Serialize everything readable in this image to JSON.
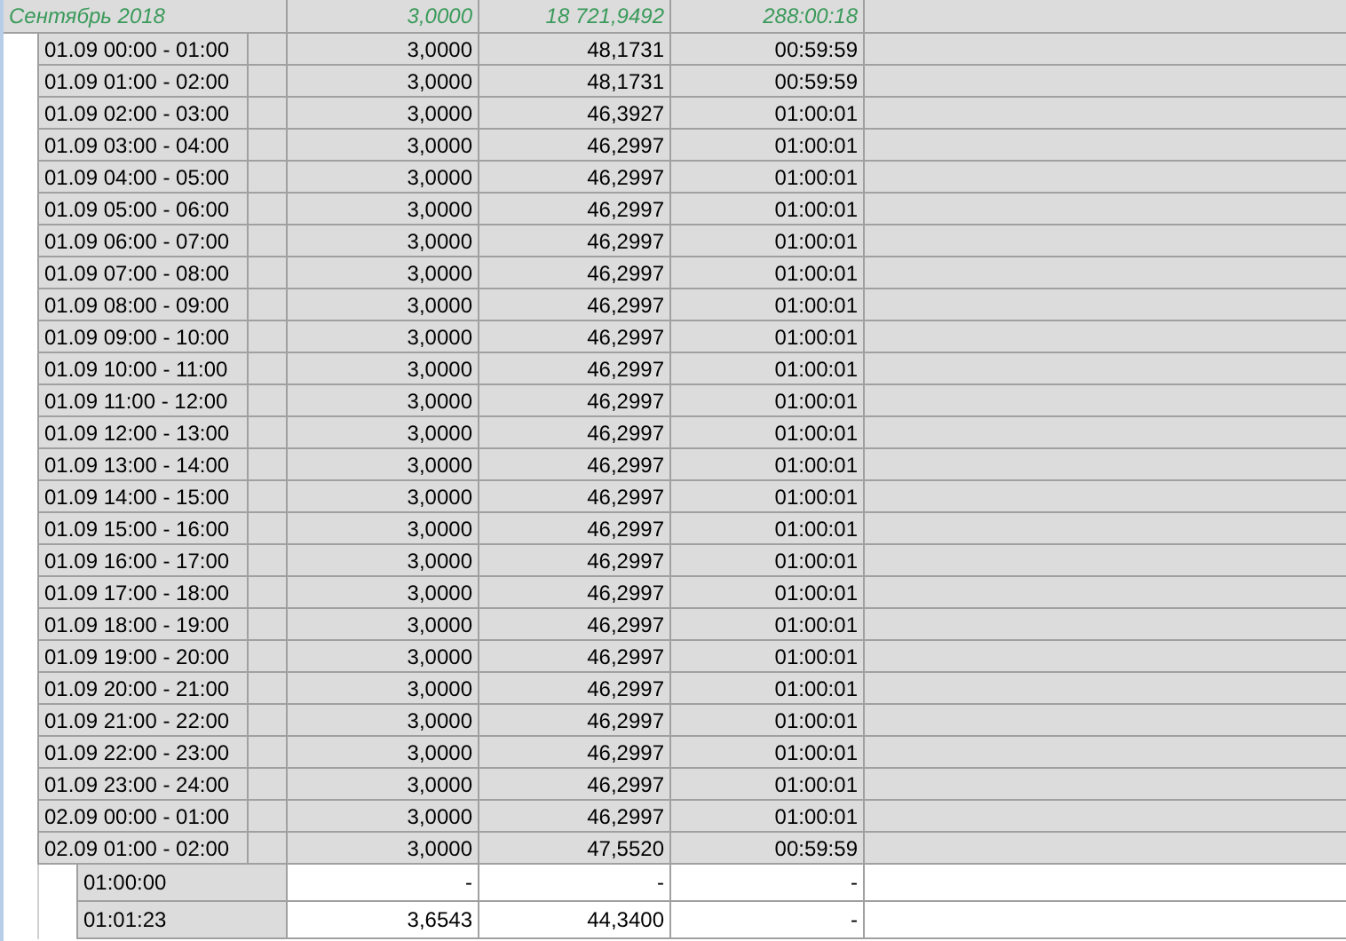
{
  "group_row": {
    "label": "Сентябрь 2018",
    "values": [
      "3,0000",
      "18 721,9492",
      "288:00:18"
    ]
  },
  "rows": [
    {
      "label": "01.09 00:00 - 01:00",
      "values": [
        "3,0000",
        "48,1731",
        "00:59:59"
      ]
    },
    {
      "label": "01.09 01:00 - 02:00",
      "values": [
        "3,0000",
        "48,1731",
        "00:59:59"
      ]
    },
    {
      "label": "01.09 02:00 - 03:00",
      "values": [
        "3,0000",
        "46,3927",
        "01:00:01"
      ]
    },
    {
      "label": "01.09 03:00 - 04:00",
      "values": [
        "3,0000",
        "46,2997",
        "01:00:01"
      ]
    },
    {
      "label": "01.09 04:00 - 05:00",
      "values": [
        "3,0000",
        "46,2997",
        "01:00:01"
      ]
    },
    {
      "label": "01.09 05:00 - 06:00",
      "values": [
        "3,0000",
        "46,2997",
        "01:00:01"
      ]
    },
    {
      "label": "01.09 06:00 - 07:00",
      "values": [
        "3,0000",
        "46,2997",
        "01:00:01"
      ]
    },
    {
      "label": "01.09 07:00 - 08:00",
      "values": [
        "3,0000",
        "46,2997",
        "01:00:01"
      ]
    },
    {
      "label": "01.09 08:00 - 09:00",
      "values": [
        "3,0000",
        "46,2997",
        "01:00:01"
      ]
    },
    {
      "label": "01.09 09:00 - 10:00",
      "values": [
        "3,0000",
        "46,2997",
        "01:00:01"
      ]
    },
    {
      "label": "01.09 10:00 - 11:00",
      "values": [
        "3,0000",
        "46,2997",
        "01:00:01"
      ]
    },
    {
      "label": "01.09 11:00 - 12:00",
      "values": [
        "3,0000",
        "46,2997",
        "01:00:01"
      ]
    },
    {
      "label": "01.09 12:00 - 13:00",
      "values": [
        "3,0000",
        "46,2997",
        "01:00:01"
      ]
    },
    {
      "label": "01.09 13:00 - 14:00",
      "values": [
        "3,0000",
        "46,2997",
        "01:00:01"
      ]
    },
    {
      "label": "01.09 14:00 - 15:00",
      "values": [
        "3,0000",
        "46,2997",
        "01:00:01"
      ]
    },
    {
      "label": "01.09 15:00 - 16:00",
      "values": [
        "3,0000",
        "46,2997",
        "01:00:01"
      ]
    },
    {
      "label": "01.09 16:00 - 17:00",
      "values": [
        "3,0000",
        "46,2997",
        "01:00:01"
      ]
    },
    {
      "label": "01.09 17:00 - 18:00",
      "values": [
        "3,0000",
        "46,2997",
        "01:00:01"
      ]
    },
    {
      "label": "01.09 18:00 - 19:00",
      "values": [
        "3,0000",
        "46,2997",
        "01:00:01"
      ]
    },
    {
      "label": "01.09 19:00 - 20:00",
      "values": [
        "3,0000",
        "46,2997",
        "01:00:01"
      ]
    },
    {
      "label": "01.09 20:00 - 21:00",
      "values": [
        "3,0000",
        "46,2997",
        "01:00:01"
      ]
    },
    {
      "label": "01.09 21:00 - 22:00",
      "values": [
        "3,0000",
        "46,2997",
        "01:00:01"
      ]
    },
    {
      "label": "01.09 22:00 - 23:00",
      "values": [
        "3,0000",
        "46,2997",
        "01:00:01"
      ]
    },
    {
      "label": "01.09 23:00 - 24:00",
      "values": [
        "3,0000",
        "46,2997",
        "01:00:01"
      ]
    },
    {
      "label": "02.09 00:00 - 01:00",
      "values": [
        "3,0000",
        "46,2997",
        "01:00:01"
      ]
    },
    {
      "label": "02.09 01:00 - 02:00",
      "values": [
        "3,0000",
        "47,5520",
        "00:59:59"
      ]
    }
  ],
  "footer_rows": [
    {
      "label": "01:00:00",
      "values": [
        "-",
        "-",
        "-"
      ]
    },
    {
      "label": "01:01:23",
      "values": [
        "3,6543",
        "44,3400",
        "-"
      ]
    }
  ]
}
